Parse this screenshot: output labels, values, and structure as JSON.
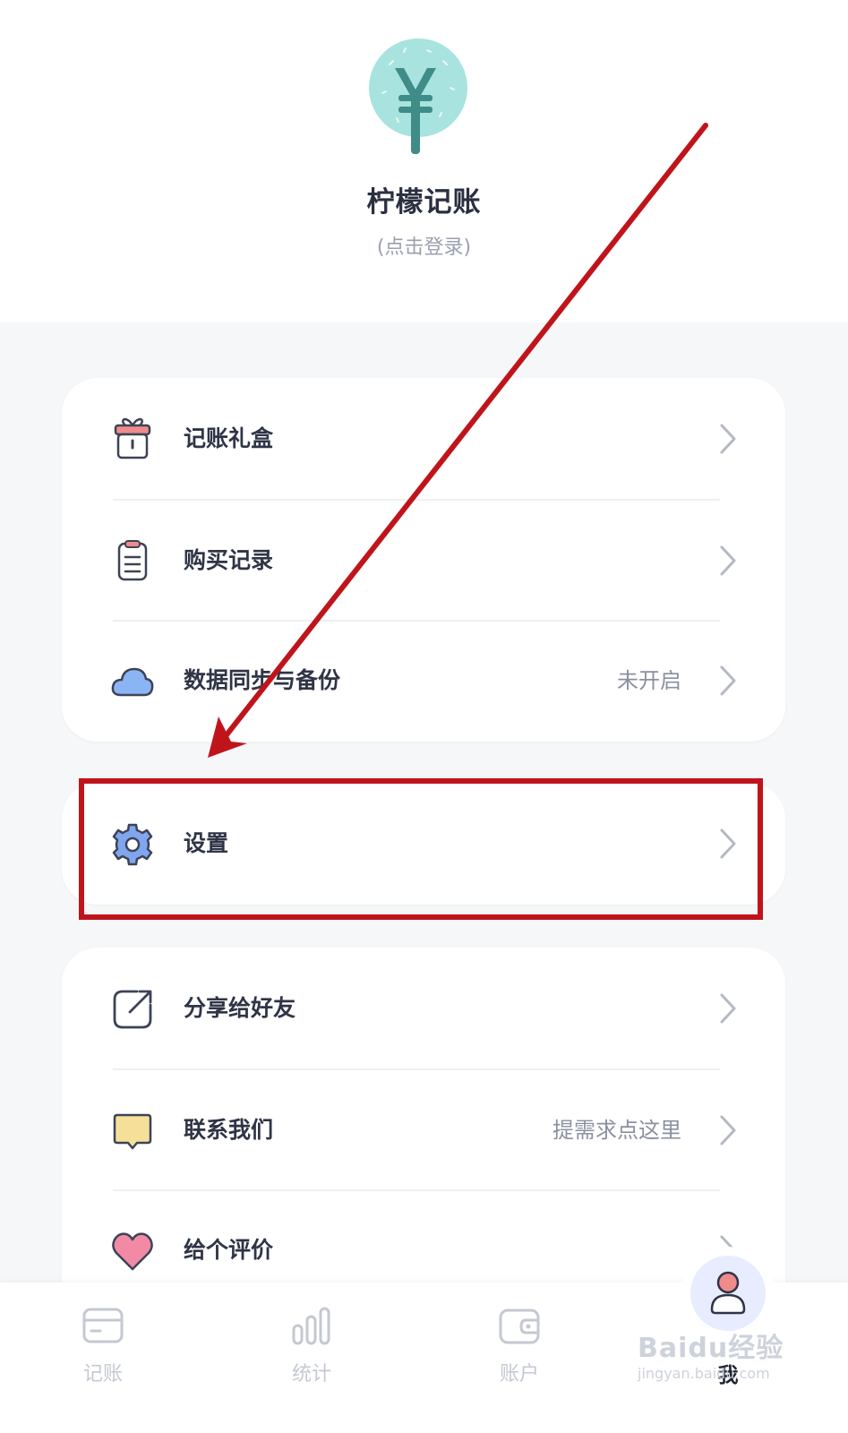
{
  "header": {
    "app_name": "柠檬记账",
    "login_hint": "(点击登录)",
    "logo_icon": "yen-tree-icon"
  },
  "menu_group_1": [
    {
      "label": "记账礼盒",
      "icon": "gift-box-icon",
      "value": ""
    },
    {
      "label": "购买记录",
      "icon": "clipboard-icon",
      "value": ""
    },
    {
      "label": "数据同步与备份",
      "icon": "cloud-icon",
      "value": "未开启"
    }
  ],
  "menu_group_2": [
    {
      "label": "设置",
      "icon": "gear-icon",
      "value": ""
    }
  ],
  "menu_group_3": [
    {
      "label": "分享给好友",
      "icon": "share-icon",
      "value": ""
    },
    {
      "label": "联系我们",
      "icon": "message-icon",
      "value": "提需求点这里"
    },
    {
      "label": "给个评价",
      "icon": "heart-icon",
      "value": ""
    }
  ],
  "tabbar": {
    "tabs": [
      {
        "label": "记账",
        "icon": "card-icon"
      },
      {
        "label": "统计",
        "icon": "bar-stats-icon"
      },
      {
        "label": "账户",
        "icon": "wallet-icon"
      },
      {
        "label": "我",
        "icon": "user-icon"
      }
    ],
    "active": "我"
  },
  "watermark": {
    "line1": "Baidu经验",
    "line2": "jingyan.baidu.com"
  },
  "colors": {
    "accent_red_annotation": "#c0141b",
    "logo_teal": "#a8e3df",
    "logo_trunk": "#3f8c88",
    "background": "#f6f7f9"
  }
}
